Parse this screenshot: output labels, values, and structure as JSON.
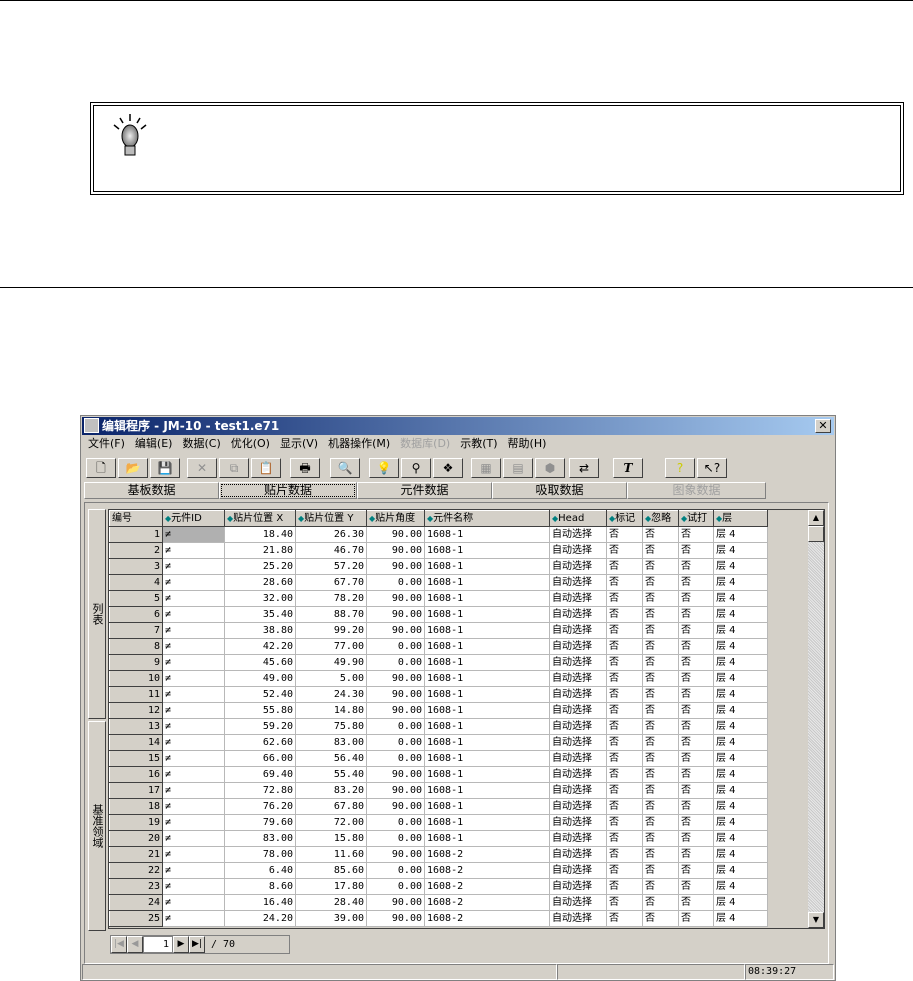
{
  "window": {
    "title": "编辑程序  - JM-10 - test1.e71",
    "close": "✕"
  },
  "menu": [
    {
      "label": "文件(F)"
    },
    {
      "label": "编辑(E)"
    },
    {
      "label": "数据(C)"
    },
    {
      "label": "优化(O)"
    },
    {
      "label": "显示(V)"
    },
    {
      "label": "机器操作(M)"
    },
    {
      "label": "数据库(D)",
      "disabled": true
    },
    {
      "label": "示教(T)"
    },
    {
      "label": "帮助(H)"
    }
  ],
  "toolbar": [
    "new-file",
    "open-folder",
    "save",
    "cut",
    "copy",
    "paste",
    "print",
    "find",
    "bulb",
    "components-a",
    "components-b",
    "tool-a",
    "tool-b",
    "tool-c",
    "swap",
    "text",
    "help",
    "context-help"
  ],
  "tabs": [
    {
      "label": "基板数据"
    },
    {
      "label": "贴片数据",
      "active": true
    },
    {
      "label": "元件数据"
    },
    {
      "label": "吸取数据"
    },
    {
      "label": "图象数据",
      "disabled": true
    }
  ],
  "side_tabs": {
    "list": "列表",
    "fiducial": "基准领域"
  },
  "columns": [
    "编号",
    "元件ID",
    "贴片位置 X",
    "贴片位置 Y",
    "贴片角度",
    "元件名称",
    "Head",
    "标记",
    "忽略",
    "试打",
    "层"
  ],
  "rows": [
    [
      "1",
      "≠",
      "18.40",
      "26.30",
      "90.00",
      "1608-1",
      "自动选择",
      "否",
      "否",
      "否",
      "层 4"
    ],
    [
      "2",
      "≠",
      "21.80",
      "46.70",
      "90.00",
      "1608-1",
      "自动选择",
      "否",
      "否",
      "否",
      "层 4"
    ],
    [
      "3",
      "≠",
      "25.20",
      "57.20",
      "90.00",
      "1608-1",
      "自动选择",
      "否",
      "否",
      "否",
      "层 4"
    ],
    [
      "4",
      "≠",
      "28.60",
      "67.70",
      "0.00",
      "1608-1",
      "自动选择",
      "否",
      "否",
      "否",
      "层 4"
    ],
    [
      "5",
      "≠",
      "32.00",
      "78.20",
      "90.00",
      "1608-1",
      "自动选择",
      "否",
      "否",
      "否",
      "层 4"
    ],
    [
      "6",
      "≠",
      "35.40",
      "88.70",
      "90.00",
      "1608-1",
      "自动选择",
      "否",
      "否",
      "否",
      "层 4"
    ],
    [
      "7",
      "≠",
      "38.80",
      "99.20",
      "90.00",
      "1608-1",
      "自动选择",
      "否",
      "否",
      "否",
      "层 4"
    ],
    [
      "8",
      "≠",
      "42.20",
      "77.00",
      "0.00",
      "1608-1",
      "自动选择",
      "否",
      "否",
      "否",
      "层 4"
    ],
    [
      "9",
      "≠",
      "45.60",
      "49.90",
      "0.00",
      "1608-1",
      "自动选择",
      "否",
      "否",
      "否",
      "层 4"
    ],
    [
      "10",
      "≠",
      "49.00",
      "5.00",
      "90.00",
      "1608-1",
      "自动选择",
      "否",
      "否",
      "否",
      "层 4"
    ],
    [
      "11",
      "≠",
      "52.40",
      "24.30",
      "90.00",
      "1608-1",
      "自动选择",
      "否",
      "否",
      "否",
      "层 4"
    ],
    [
      "12",
      "≠",
      "55.80",
      "14.80",
      "90.00",
      "1608-1",
      "自动选择",
      "否",
      "否",
      "否",
      "层 4"
    ],
    [
      "13",
      "≠",
      "59.20",
      "75.80",
      "0.00",
      "1608-1",
      "自动选择",
      "否",
      "否",
      "否",
      "层 4"
    ],
    [
      "14",
      "≠",
      "62.60",
      "83.00",
      "0.00",
      "1608-1",
      "自动选择",
      "否",
      "否",
      "否",
      "层 4"
    ],
    [
      "15",
      "≠",
      "66.00",
      "56.40",
      "0.00",
      "1608-1",
      "自动选择",
      "否",
      "否",
      "否",
      "层 4"
    ],
    [
      "16",
      "≠",
      "69.40",
      "55.40",
      "90.00",
      "1608-1",
      "自动选择",
      "否",
      "否",
      "否",
      "层 4"
    ],
    [
      "17",
      "≠",
      "72.80",
      "83.20",
      "90.00",
      "1608-1",
      "自动选择",
      "否",
      "否",
      "否",
      "层 4"
    ],
    [
      "18",
      "≠",
      "76.20",
      "67.80",
      "90.00",
      "1608-1",
      "自动选择",
      "否",
      "否",
      "否",
      "层 4"
    ],
    [
      "19",
      "≠",
      "79.60",
      "72.00",
      "0.00",
      "1608-1",
      "自动选择",
      "否",
      "否",
      "否",
      "层 4"
    ],
    [
      "20",
      "≠",
      "83.00",
      "15.80",
      "0.00",
      "1608-1",
      "自动选择",
      "否",
      "否",
      "否",
      "层 4"
    ],
    [
      "21",
      "≠",
      "78.00",
      "11.60",
      "90.00",
      "1608-2",
      "自动选择",
      "否",
      "否",
      "否",
      "层 4"
    ],
    [
      "22",
      "≠",
      "6.40",
      "85.60",
      "0.00",
      "1608-2",
      "自动选择",
      "否",
      "否",
      "否",
      "层 4"
    ],
    [
      "23",
      "≠",
      "8.60",
      "17.80",
      "0.00",
      "1608-2",
      "自动选择",
      "否",
      "否",
      "否",
      "层 4"
    ],
    [
      "24",
      "≠",
      "16.40",
      "28.40",
      "90.00",
      "1608-2",
      "自动选择",
      "否",
      "否",
      "否",
      "层 4"
    ],
    [
      "25",
      "≠",
      "24.20",
      "39.00",
      "90.00",
      "1608-2",
      "自动选择",
      "否",
      "否",
      "否",
      "层 4"
    ]
  ],
  "pager": {
    "current": "1",
    "total": "/ 70"
  },
  "status": {
    "time": "08:39:27"
  }
}
